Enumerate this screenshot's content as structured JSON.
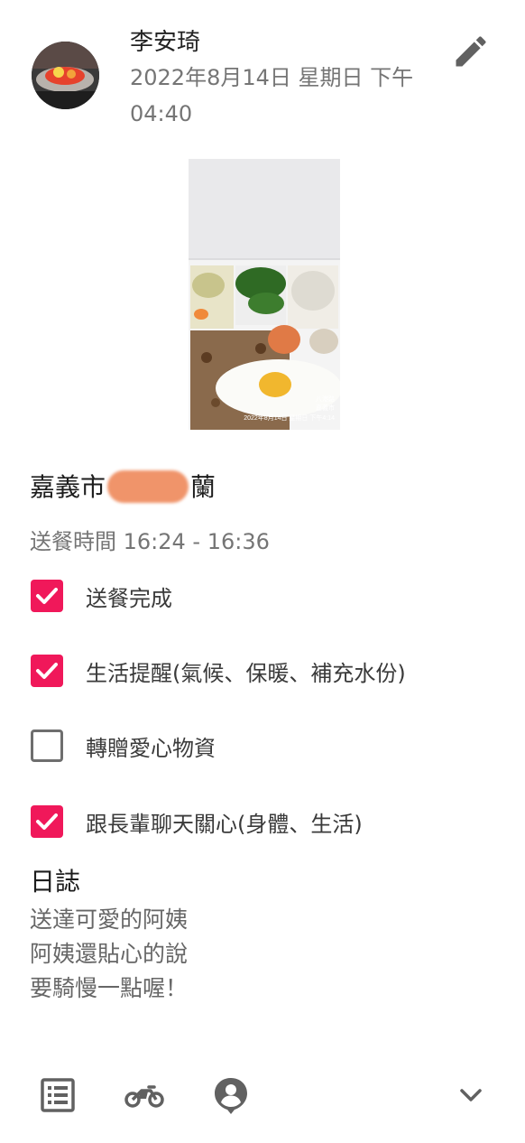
{
  "post": {
    "author": "李安琦",
    "datetime": "2022年8月14日 星期日 下午04:40"
  },
  "photo": {
    "watermark_line1": "八港路",
    "watermark_line2": "嘉義市",
    "watermark_date": "2022年8月14日 星期日 下午4:14"
  },
  "recipient": {
    "address_prefix": "嘉義市",
    "address_suffix": "蘭"
  },
  "delivery": {
    "time_text": "送餐時間 16:24 - 16:36"
  },
  "checklist": [
    {
      "label": "送餐完成",
      "checked": true
    },
    {
      "label": "生活提醒(氣候、保暖、補充水份)",
      "checked": true
    },
    {
      "label": "轉贈愛心物資",
      "checked": false
    },
    {
      "label": "跟長輩聊天關心(身體、生活)",
      "checked": true
    }
  ],
  "log": {
    "title": "日誌",
    "lines": [
      "送達可愛的阿姨",
      "阿姨還貼心的說",
      "要騎慢一點喔！"
    ]
  },
  "toolbar": {
    "icons": [
      "list-icon",
      "motorcycle-icon",
      "person-pin-icon",
      "chevron-down-icon"
    ]
  },
  "colors": {
    "accent": "#f0185a",
    "secondary_text": "#757575",
    "icon": "#616161"
  }
}
